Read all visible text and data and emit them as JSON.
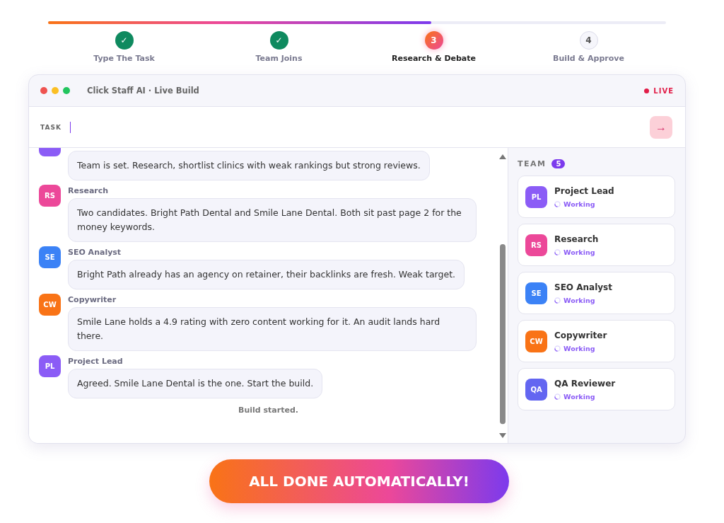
{
  "progress": {
    "level": 0.62
  },
  "steps": [
    {
      "label": "Type The Task",
      "marker": "✓",
      "done": true,
      "selected": false
    },
    {
      "label": "Team Joins",
      "marker": "✓",
      "done": true,
      "selected": false
    },
    {
      "label": "Research & Debate",
      "marker": "3",
      "done": false,
      "selected": true
    },
    {
      "label": "Build & Approve",
      "marker": "4",
      "done": false,
      "selected": false
    }
  ],
  "window": {
    "title": "Click Staff AI · Live Build",
    "live": "LIVE"
  },
  "task": {
    "label": "TASK",
    "arrow": "→"
  },
  "messages": [
    {
      "color": "#8b5cf6",
      "clipped": true,
      "text": "Team is set. Research, shortlist clinics with weak rankings but strong reviews."
    },
    {
      "sender": "Research",
      "initials": "RS",
      "color": "#ec4899",
      "text": "Two candidates. Bright Path Dental and Smile Lane Dental. Both sit past page 2 for the money keywords."
    },
    {
      "sender": "SEO Analyst",
      "initials": "SE",
      "color": "#3b82f6",
      "text": "Bright Path already has an agency on retainer, their backlinks are fresh. Weak target."
    },
    {
      "sender": "Copywriter",
      "initials": "CW",
      "color": "#f97316",
      "text": "Smile Lane holds a 4.9 rating with zero content working for it. An audit lands hard there."
    },
    {
      "sender": "Project Lead",
      "initials": "PL",
      "color": "#8b5cf6",
      "text": "Agreed. Smile Lane Dental is the one. Start the build."
    }
  ],
  "system_note": "Build started.",
  "team": {
    "title": "TEAM",
    "count": "5",
    "members": [
      {
        "name": "Project Lead",
        "initials": "PL",
        "color": "#8b5cf6",
        "status": "Working"
      },
      {
        "name": "Research",
        "initials": "RS",
        "color": "#ec4899",
        "status": "Working"
      },
      {
        "name": "SEO Analyst",
        "initials": "SE",
        "color": "#3b82f6",
        "status": "Working"
      },
      {
        "name": "Copywriter",
        "initials": "CW",
        "color": "#f97316",
        "status": "Working"
      },
      {
        "name": "QA Reviewer",
        "initials": "QA",
        "color": "#6366f1",
        "status": "Working"
      }
    ]
  },
  "cta": "ALL DONE AUTOMATICALLY!"
}
